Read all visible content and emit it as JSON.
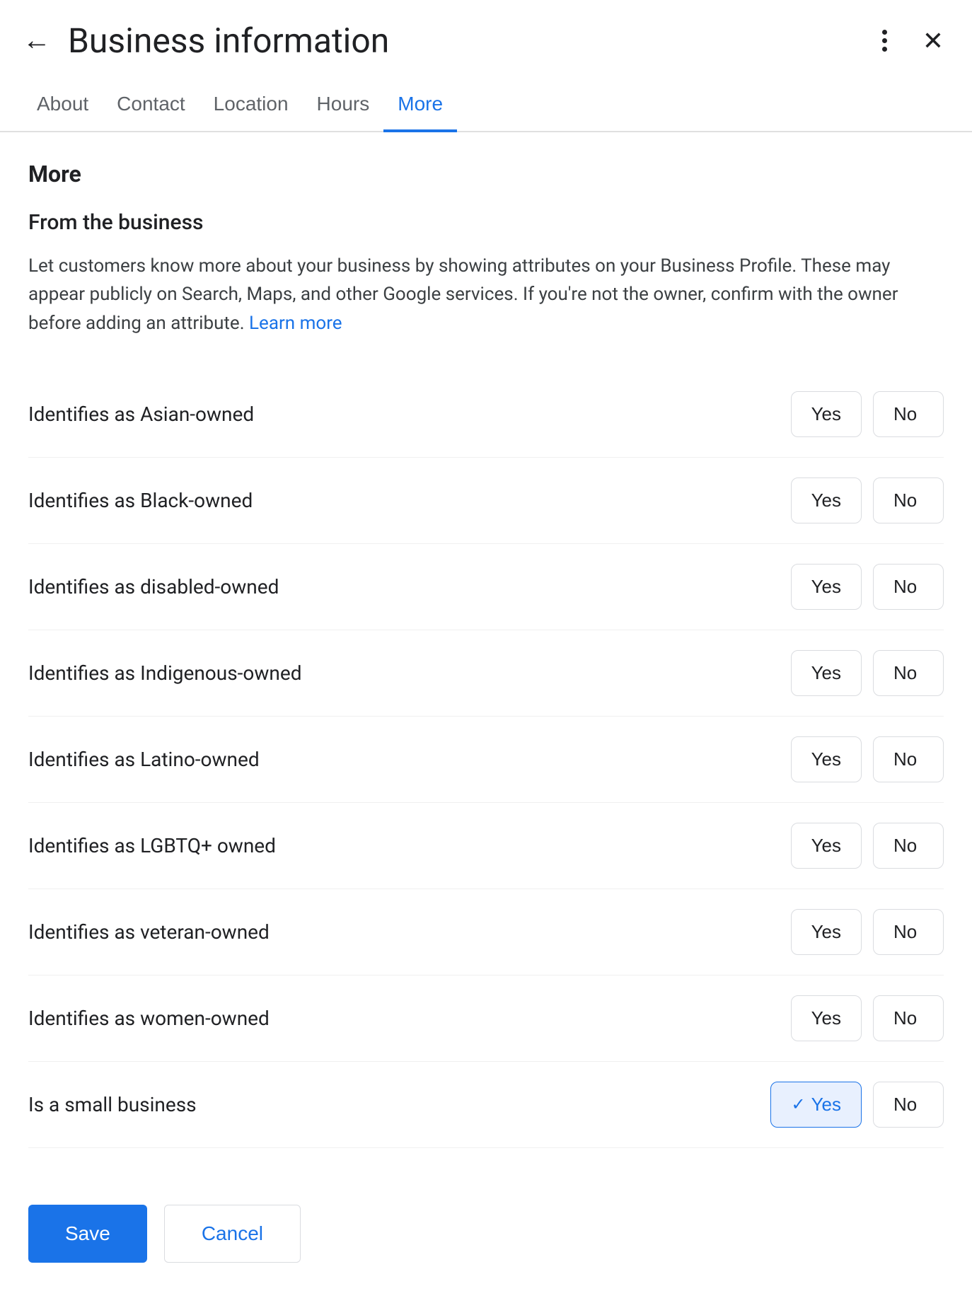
{
  "header": {
    "title": "Business information",
    "back_label": "←",
    "more_icon": "more-vert",
    "close_icon": "close"
  },
  "tabs": [
    {
      "id": "about",
      "label": "About",
      "active": false
    },
    {
      "id": "contact",
      "label": "Contact",
      "active": false
    },
    {
      "id": "location",
      "label": "Location",
      "active": false
    },
    {
      "id": "hours",
      "label": "Hours",
      "active": false
    },
    {
      "id": "more",
      "label": "More",
      "active": true
    }
  ],
  "main": {
    "section_title": "More",
    "subsection_title": "From the business",
    "description": "Let customers know more about your business by showing attributes on your Business Profile. These may appear publicly on Search, Maps, and other Google services. If you're not the owner, confirm with the owner before adding an attribute.",
    "learn_more_label": "Learn more",
    "attributes": [
      {
        "label": "Identifies as Asian-owned",
        "yes_selected": false,
        "no_selected": false
      },
      {
        "label": "Identifies as Black-owned",
        "yes_selected": false,
        "no_selected": false
      },
      {
        "label": "Identifies as disabled-owned",
        "yes_selected": false,
        "no_selected": false
      },
      {
        "label": "Identifies as Indigenous-owned",
        "yes_selected": false,
        "no_selected": false
      },
      {
        "label": "Identifies as Latino-owned",
        "yes_selected": false,
        "no_selected": false
      },
      {
        "label": "Identifies as LGBTQ+ owned",
        "yes_selected": false,
        "no_selected": false
      },
      {
        "label": "Identifies as veteran-owned",
        "yes_selected": false,
        "no_selected": false
      },
      {
        "label": "Identifies as women-owned",
        "yes_selected": false,
        "no_selected": false
      },
      {
        "label": "Is a small business",
        "yes_selected": true,
        "no_selected": false
      }
    ]
  },
  "footer": {
    "save_label": "Save",
    "cancel_label": "Cancel"
  }
}
